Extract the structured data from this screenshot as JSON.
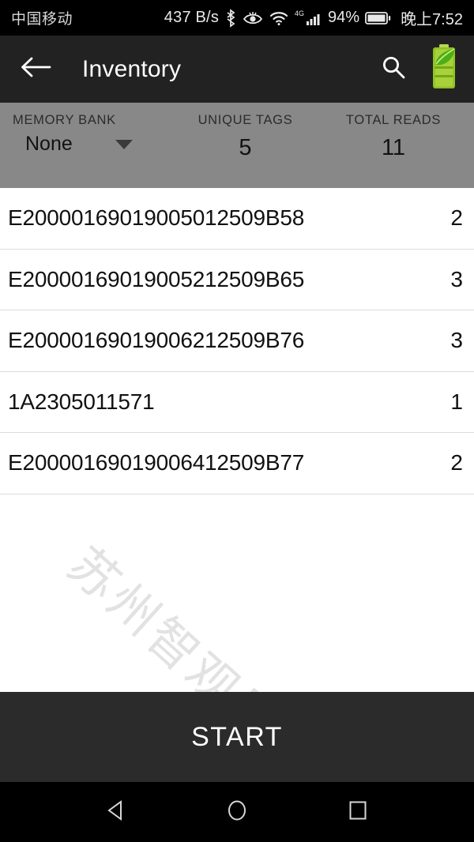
{
  "status_bar": {
    "carrier": "中国移动",
    "network_speed": "437 B/s",
    "bluetooth_icon": "bluetooth-icon",
    "eye_icon": "eye-care-icon",
    "wifi_icon": "wifi-icon",
    "network_type": "4G",
    "signal_icon": "cellular-signal-icon",
    "battery_percent": "94%",
    "battery_icon": "battery-icon",
    "clock": "晚上7:52"
  },
  "app_bar": {
    "back_icon": "back-arrow-icon",
    "title": "Inventory",
    "search_icon": "search-icon",
    "eco_battery_icon": "eco-battery-leaf-icon"
  },
  "stats": {
    "memory_bank_label": "MEMORY BANK",
    "memory_bank_value": "None",
    "memory_bank_caret_icon": "chevron-down-icon",
    "unique_tags_label": "UNIQUE TAGS",
    "unique_tags_value": "5",
    "total_reads_label": "TOTAL READS",
    "total_reads_value": "11"
  },
  "tag_list": [
    {
      "epc": "E20000169019005012509B58",
      "count": "2"
    },
    {
      "epc": "E20000169019005212509B65",
      "count": "3"
    },
    {
      "epc": "E20000169019006212509B76",
      "count": "3"
    },
    {
      "epc": "1A2305011571",
      "count": "1"
    },
    {
      "epc": "E20000169019006412509B77",
      "count": "2"
    }
  ],
  "watermark": "苏州智观昂盛",
  "start_button": {
    "label": "START"
  },
  "nav_bar": {
    "back_icon": "nav-back-triangle-icon",
    "home_icon": "nav-home-circle-icon",
    "recents_icon": "nav-recents-square-icon"
  },
  "colors": {
    "status_bar_bg": "#000000",
    "app_bar_bg": "#222222",
    "stats_bar_bg": "#888888",
    "list_bg": "#ffffff",
    "start_button_bg": "#2b2b2b",
    "nav_bar_bg": "#000000",
    "eco_green": "#8ec31f",
    "divider": "#dcdcdc"
  }
}
